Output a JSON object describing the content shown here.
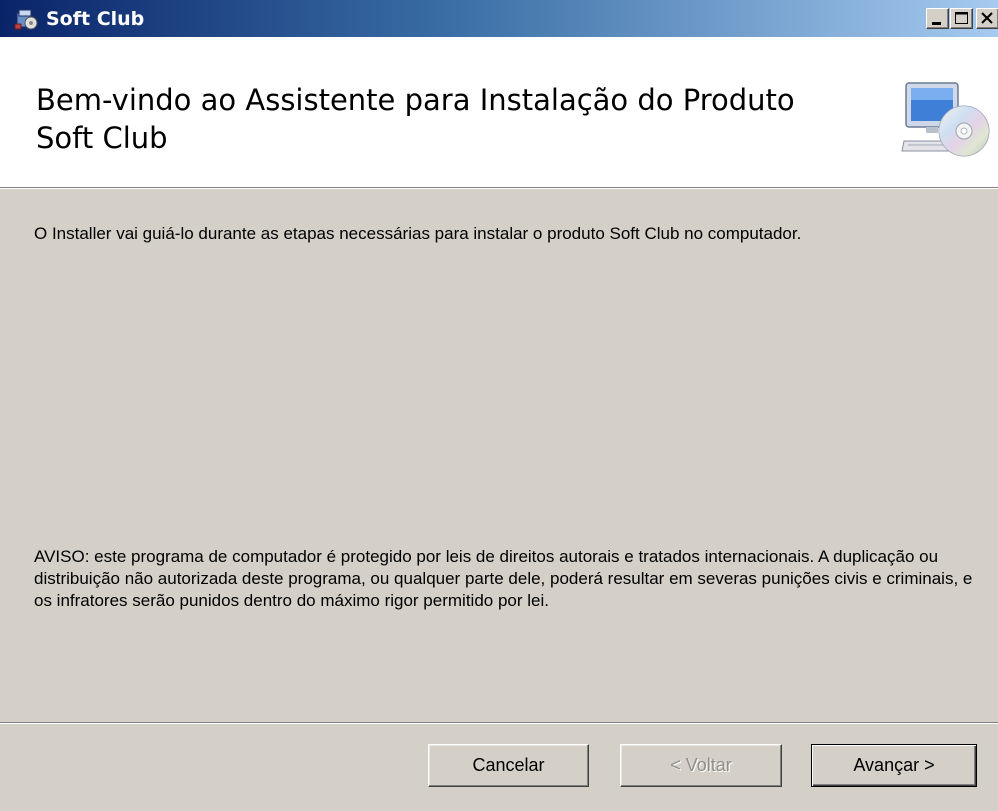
{
  "window": {
    "title": "Soft Club",
    "controls": {
      "minimize_icon": "minimize-icon",
      "maximize_icon": "maximize-icon",
      "close_icon": "close-icon"
    }
  },
  "header": {
    "title": "Bem-vindo ao Assistente para Instalação do Produto Soft Club",
    "icon": "computer-cd-icon"
  },
  "content": {
    "intro": "O Installer vai guiá-lo durante as etapas necessárias para instalar o produto Soft Club no computador.",
    "warning": "AVISO: este programa de computador é protegido por leis de direitos autorais e tratados internacionais. A duplicação ou distribuição não autorizada deste programa, ou qualquer parte dele, poderá resultar em severas punições civis e criminais, e os infratores serão punidos dentro do máximo rigor permitido por lei."
  },
  "buttons": {
    "cancel": "Cancelar",
    "back": "< Voltar",
    "next": "Avançar >"
  },
  "colors": {
    "titlebar_start": "#0a246a",
    "titlebar_end": "#a6caf0",
    "dialog_bg": "#d4d0c8",
    "header_bg": "#ffffff"
  }
}
